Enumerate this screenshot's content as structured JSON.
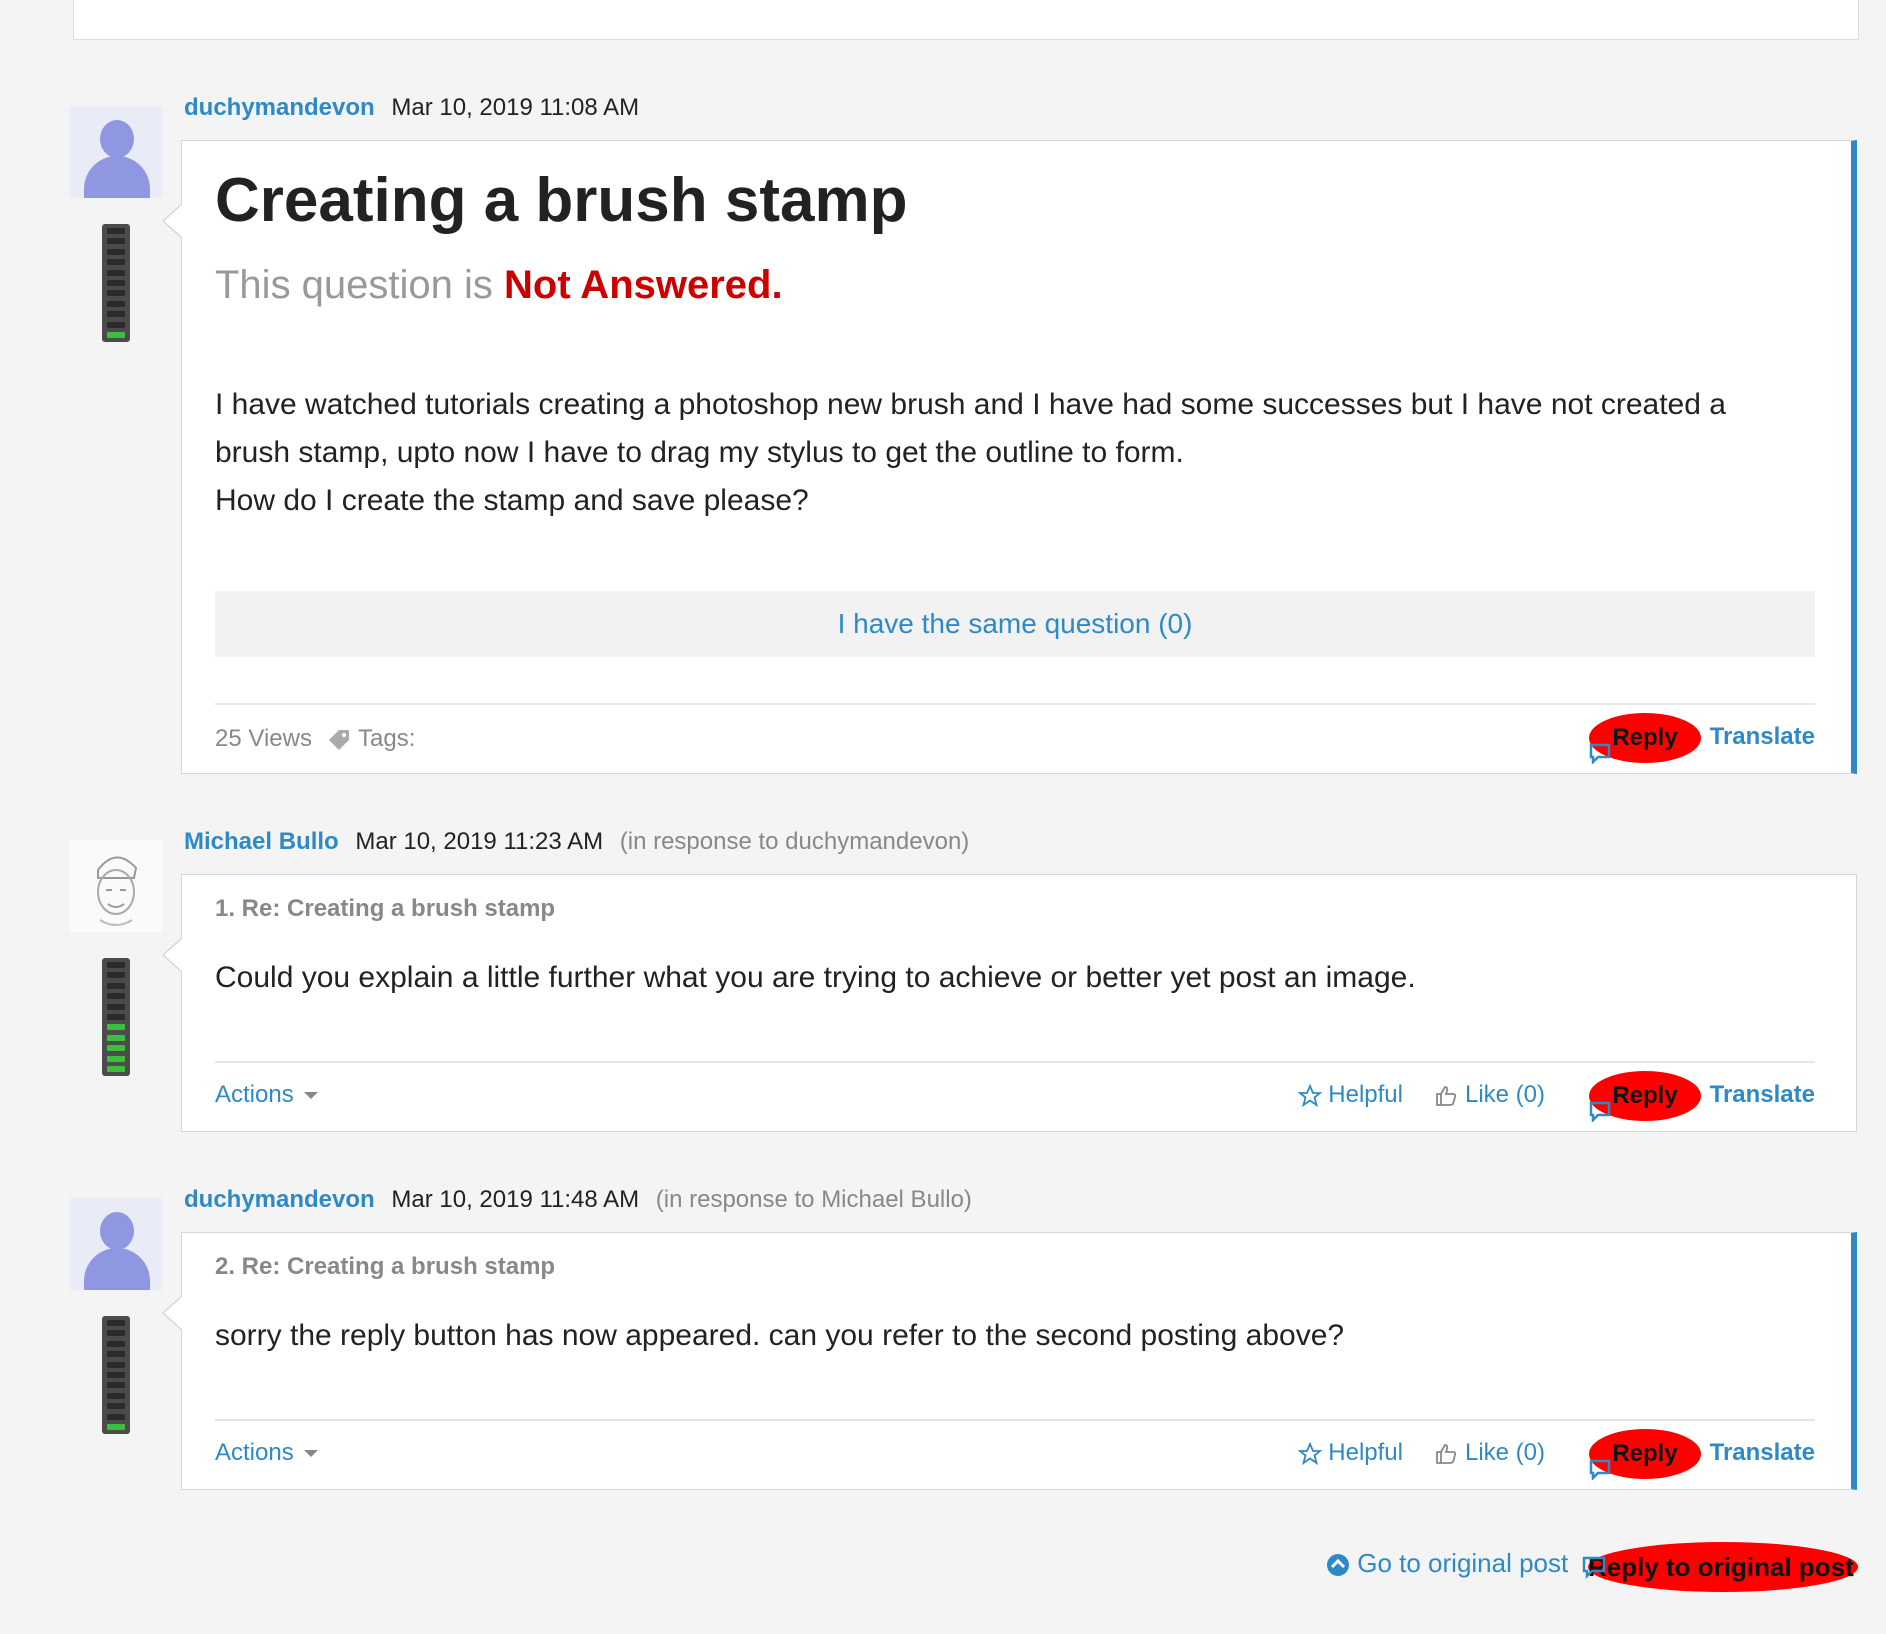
{
  "posts": [
    {
      "user": "duchymandevon",
      "date": "Mar 10, 2019 11:08 AM",
      "title": "Creating a brush stamp",
      "status_prefix": "This question is ",
      "status_value": "Not Answered.",
      "body": [
        "I have watched tutorials creating a photoshop new brush and I have had some successes but I have not created a brush stamp, upto now I have to drag my stylus to get the outline to form.",
        "How do I create the stamp and save please?"
      ],
      "same_question": "I have the same question (0)",
      "views": "25 Views",
      "tags_label": "Tags:",
      "reply": "Reply",
      "translate": "Translate"
    },
    {
      "user": "Michael Bullo",
      "date": "Mar 10, 2019 11:23 AM",
      "in_response": "(in response to duchymandevon)",
      "title": "1. Re: Creating a brush stamp",
      "body": "Could you explain a little further what you are trying to achieve or better yet post an image.",
      "actions": "Actions",
      "helpful": "Helpful",
      "like": "Like (0)",
      "reply": "Reply",
      "translate": "Translate"
    },
    {
      "user": "duchymandevon",
      "date": "Mar 10, 2019 11:48 AM",
      "in_response": "(in response to Michael Bullo)",
      "title": "2. Re: Creating a brush stamp",
      "body": "sorry the reply button has now appeared. can you refer to the second posting above?",
      "actions": "Actions",
      "helpful": "Helpful",
      "like": "Like (0)",
      "reply": "Reply",
      "translate": "Translate"
    }
  ],
  "bottom": {
    "go_original": "Go to original post",
    "reply_original": "Reply to original post"
  },
  "colors": {
    "link": "#2d8ac7",
    "not_answered": "#cc0000",
    "highlight": "#ff0000",
    "meter_on": "#3cbf3c"
  }
}
